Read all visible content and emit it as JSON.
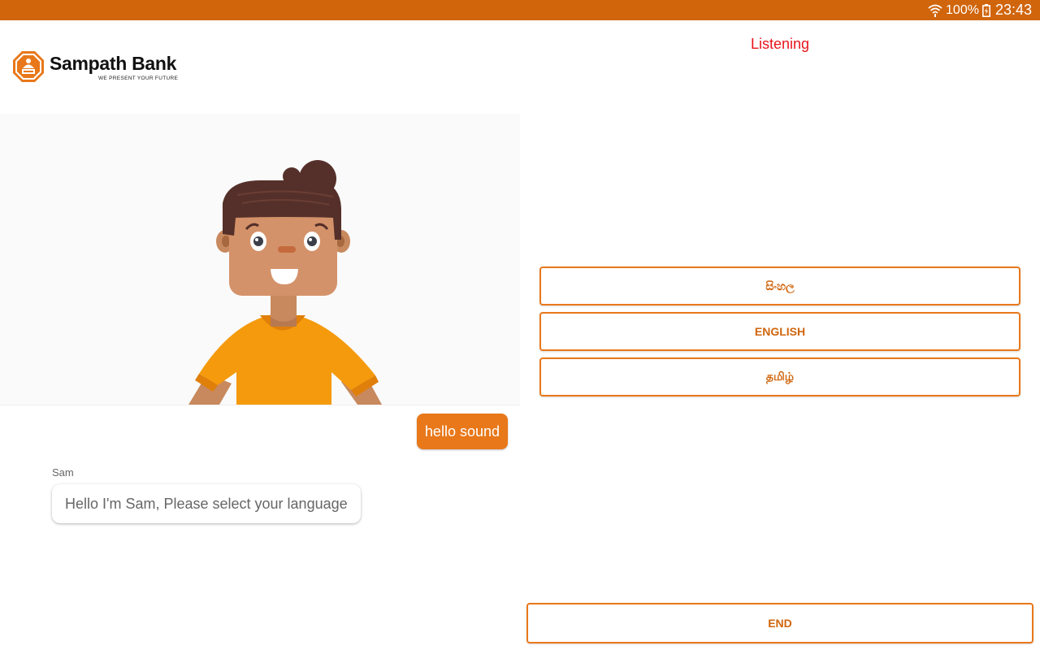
{
  "status_bar": {
    "battery": "100%",
    "time": "23:43"
  },
  "brand": {
    "name": "Sampath Bank",
    "tagline": "WE PRESENT YOUR FUTURE",
    "accent_color": "#e8781a",
    "status_bar_color": "#d0650c"
  },
  "status_label": "Listening",
  "chat": {
    "user_message": "hello sound",
    "bot_name": "Sam",
    "bot_message": "Hello I'm Sam, Please select your language"
  },
  "languages": [
    {
      "label": "සිංහල"
    },
    {
      "label": "ENGLISH"
    },
    {
      "label": "தமிழ்"
    }
  ],
  "end_label": "END",
  "icons": [
    "wifi-icon",
    "battery-charging-icon",
    "sampath-logo-icon",
    "assistant-avatar"
  ]
}
